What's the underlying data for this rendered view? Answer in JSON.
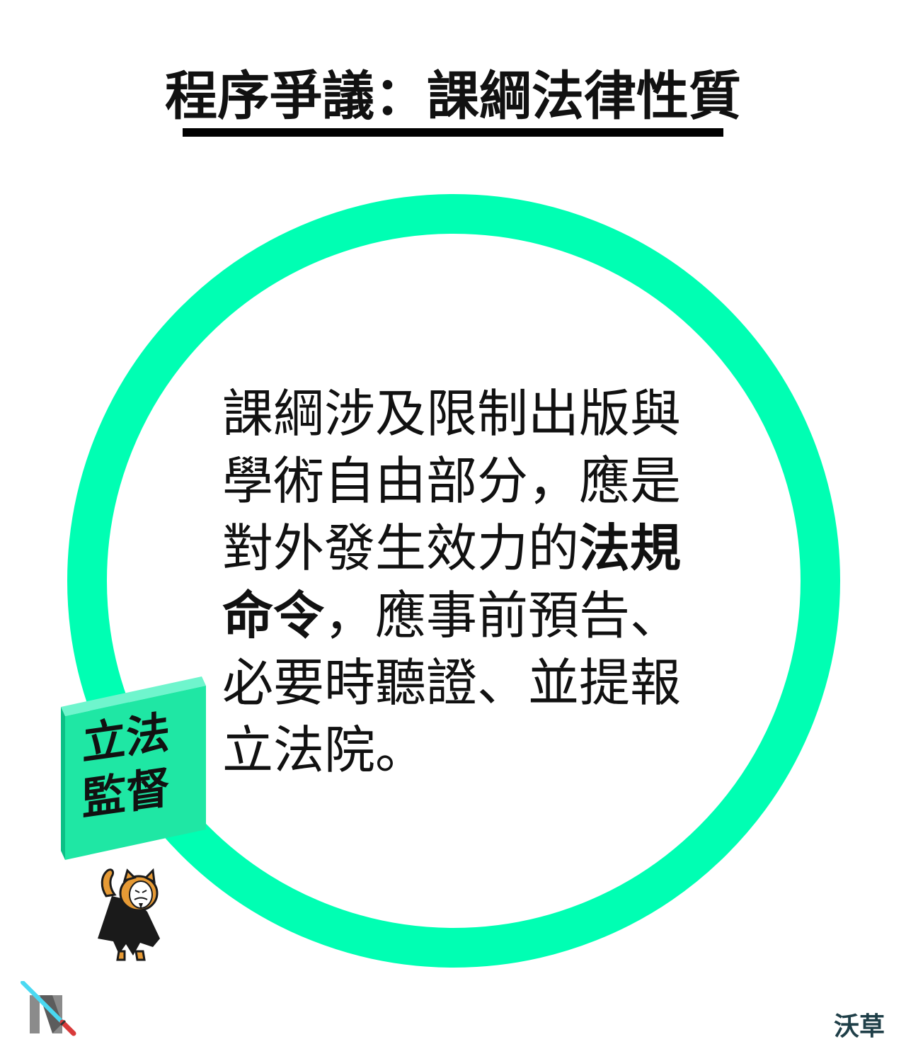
{
  "title": "程序爭議：課綱法律性質",
  "body": {
    "before": "課綱涉及限制出版與學術自由部分，應是對外發生效力的",
    "highlight": "法規命令",
    "after": "，應事前預告、必要時聽證、並提報立法院。"
  },
  "tag": {
    "line1": "立法",
    "line2": "監督"
  },
  "brand": "沃草",
  "colors": {
    "accent": "#00ffb3",
    "tag_front": "#1fe7a4",
    "tag_side": "#0cbf86",
    "tag_top": "#6ff5cd",
    "text": "#111111",
    "brand": "#1f3f48"
  },
  "icons": {
    "mascot": "masked-cat-mascot-icon",
    "logo": "lightsaber-logo-icon"
  }
}
